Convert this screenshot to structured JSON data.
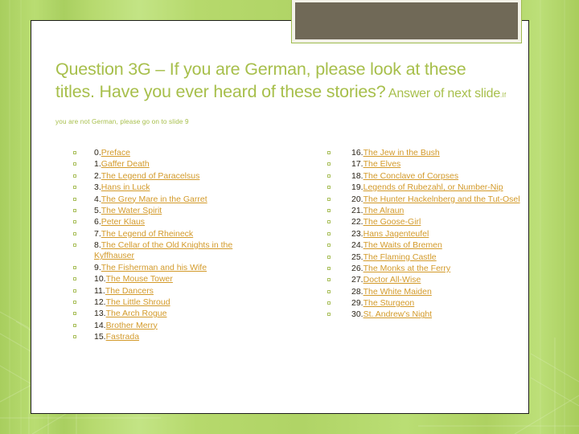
{
  "slide": {
    "title_main": "Question 3G – If you are German, please look at these titles. Have you ever  heard of these stories?",
    "title_tail": " Answer of next slide",
    "title_note": ".If you are not German, please go on to slide 9",
    "accent_color": "#a7bf4b",
    "link_color": "#d39a2a",
    "background_color": "#b5d96a",
    "panel_color": "#ffffff",
    "decor_block_color": "#706957"
  },
  "left_column": {
    "items": [
      {
        "number": "0.",
        "title": "Preface"
      },
      {
        "number": "1.",
        "title": "Gaffer Death"
      },
      {
        "number": "2.",
        "title": "The Legend of Paracelsus"
      },
      {
        "number": "3.",
        "title": "Hans in Luck"
      },
      {
        "number": "4.",
        "title": "The Grey Mare in the Garret"
      },
      {
        "number": "5.",
        "title": "The Water Spirit"
      },
      {
        "number": "6.",
        "title": "Peter Klaus"
      },
      {
        "number": "7.",
        "title": "The Legend of Rheineck"
      },
      {
        "number": "8.",
        "title": "The Cellar of the Old Knights in the Kyffhauser"
      },
      {
        "number": "9.",
        "title": "The Fisherman and his Wife"
      },
      {
        "number": "10.",
        "title": "The Mouse Tower"
      },
      {
        "number": "11.",
        "title": "The Dancers"
      },
      {
        "number": "12.",
        "title": "The Little Shroud"
      },
      {
        "number": "13.",
        "title": "The Arch Rogue"
      },
      {
        "number": "14.",
        "title": "Brother Merry"
      },
      {
        "number": "15.",
        "title": "Fastrada"
      }
    ]
  },
  "right_column": {
    "items": [
      {
        "number": "16.",
        "title": "The Jew in the Bush"
      },
      {
        "number": "17.",
        "title": "The Elves"
      },
      {
        "number": "18.",
        "title": "The Conclave of Corpses"
      },
      {
        "number": "19.",
        "title": "Legends of Rubezahl, or Number-Nip"
      },
      {
        "number": "20.",
        "title": "The Hunter Hackelnberg and the Tut-Osel"
      },
      {
        "number": "21.",
        "title": "The Alraun"
      },
      {
        "number": "22.",
        "title": "The Goose-Girl"
      },
      {
        "number": "23.",
        "title": "Hans Jagenteufel"
      },
      {
        "number": "24.",
        "title": "The Waits of Bremen"
      },
      {
        "number": "25.",
        "title": "The Flaming Castle"
      },
      {
        "number": "26.",
        "title": "The Monks at the Ferry"
      },
      {
        "number": "27.",
        "title": "Doctor All-Wise"
      },
      {
        "number": "28.",
        "title": "The White Maiden"
      },
      {
        "number": "29.",
        "title": "The Sturgeon"
      },
      {
        "number": "30.",
        "title": "St. Andrew's Night"
      }
    ]
  }
}
